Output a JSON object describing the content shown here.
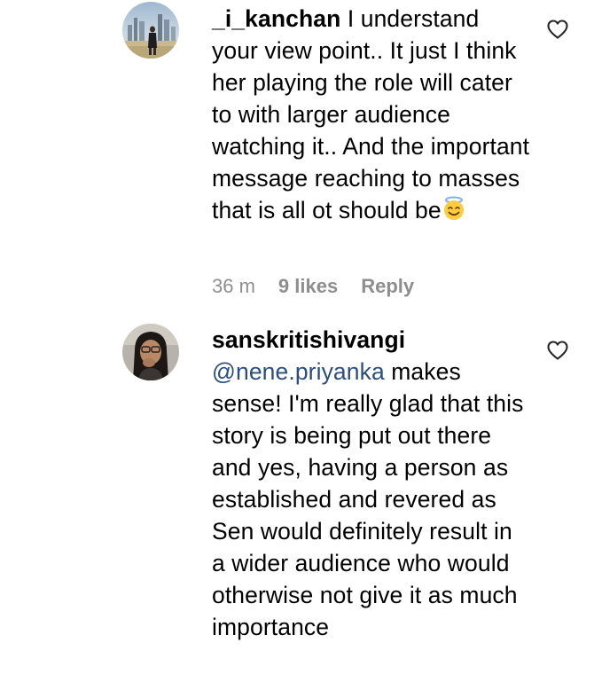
{
  "comments": [
    {
      "username": "_i_kanchan",
      "text": "I understand your view point.. It just I think her playing the role will cater to with larger audience watching it.. And the important message reaching to masses that is all ot should be",
      "emoji": "smiling-face-with-halo",
      "time": "36 m",
      "likes": "9 likes",
      "reply_label": "Reply"
    },
    {
      "username": "sanskritishivangi",
      "mention": "@nene.priyanka",
      "text": "makes sense! I'm really glad that this story is being put out there and yes, having a person as established and revered as Sen would definitely result in a wider audience who would otherwise not give it as much importance"
    }
  ],
  "colors": {
    "mention": "#2b4e7e",
    "meta": "#8e8e8e",
    "text": "#000000"
  },
  "icons": {
    "like": "heart-outline-icon"
  }
}
